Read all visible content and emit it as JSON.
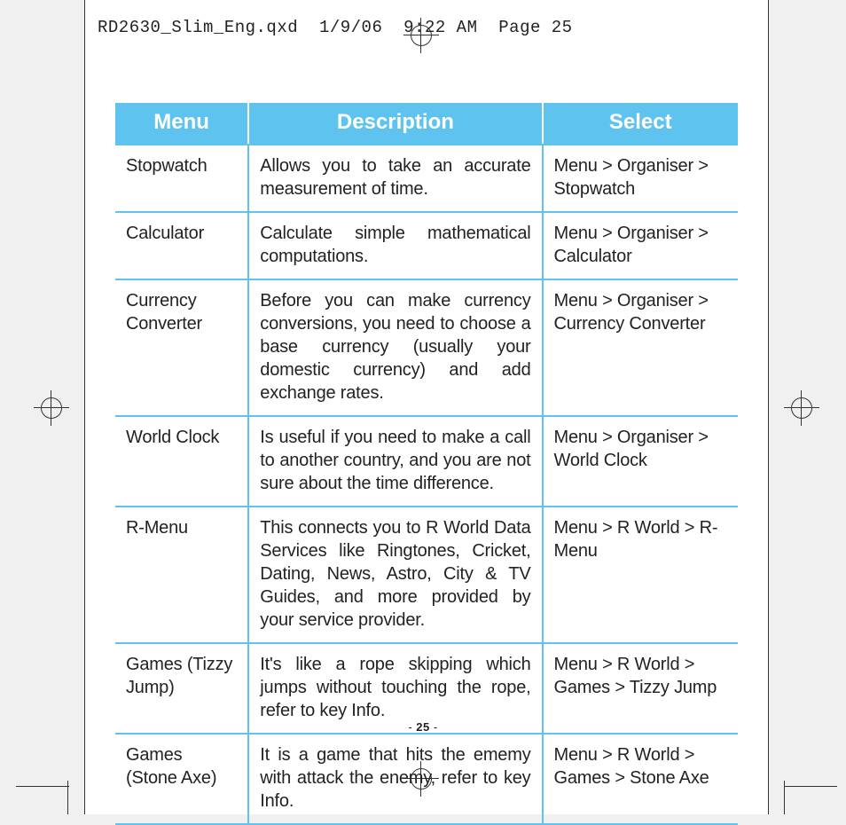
{
  "print_header": "RD2630_Slim_Eng.qxd  1/9/06  9:22 AM  Page 25",
  "page_number_display": "- 25 -",
  "columns": {
    "menu": "Menu",
    "description": "Description",
    "select": "Select"
  },
  "rows": [
    {
      "menu": "Stopwatch",
      "description": "Allows you to take an accurate measurement of time.",
      "select": "Menu > Organiser > Stopwatch"
    },
    {
      "menu": "Calculator",
      "description": "Calculate simple mathematical computations.",
      "select": "Menu > Organiser > Calculator"
    },
    {
      "menu": "Currency Converter",
      "description": "Before you can make currency conversions, you need to choose a base currency (usually your domestic currency) and add exchange rates.",
      "select": "Menu > Organiser > Currency Converter"
    },
    {
      "menu": "World Clock",
      "description": "Is useful if you need to make a call to another country, and you are not sure about the time difference.",
      "select": "Menu > Organiser > World Clock"
    },
    {
      "menu": "R-Menu",
      "description": "This connects you to R World Data Services like Ringtones, Cricket, Dating,  News, Astro, City & TV Guides, and more provided by your service provider.",
      "select": "Menu > R World > R-Menu"
    },
    {
      "menu": "Games (Tizzy Jump)",
      "description": "It's like a rope skipping which jumps without touching the rope, refer to key Info.",
      "select": "Menu > R World > Games >  Tizzy Jump"
    },
    {
      "menu": "Games (Stone Axe)",
      "description": "It is a game that hits the ememy with attack the enemy, refer to key Info.",
      "select": "Menu > R World > Games >  Stone Axe"
    }
  ]
}
